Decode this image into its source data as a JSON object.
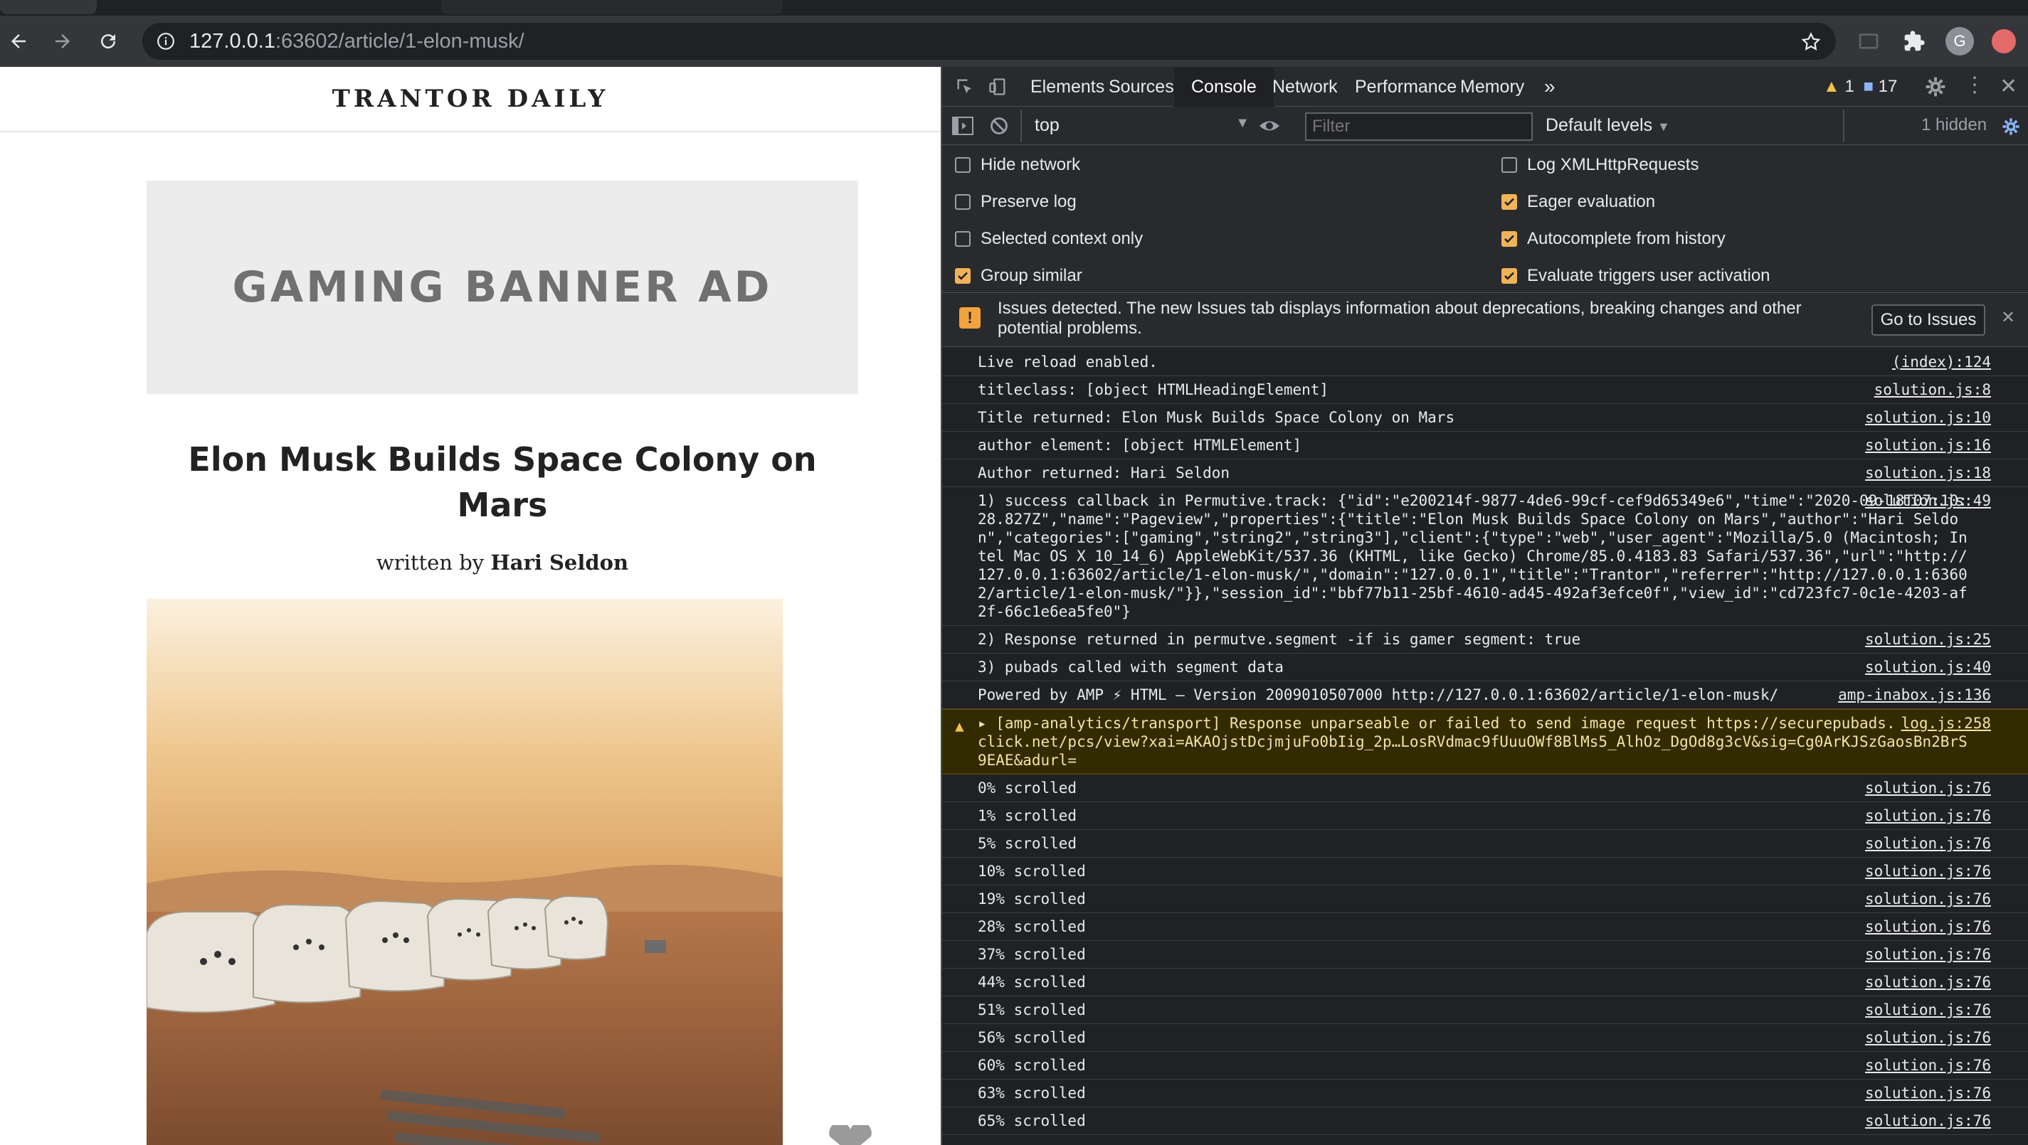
{
  "browser": {
    "url_host": "127.0.0.1",
    "url_path": ":63602/article/1-elon-musk/",
    "profile_initial": "G"
  },
  "page": {
    "masthead": "TRANTOR DAILY",
    "ad_text": "GAMING BANNER AD",
    "article_title": "Elon Musk Builds Space Colony on Mars",
    "byline_prefix": "written by",
    "author": "Hari Seldon"
  },
  "devtools": {
    "tabs": [
      "Elements",
      "Sources",
      "Console",
      "Network",
      "Performance",
      "Memory"
    ],
    "active_tab": "Console",
    "warnings_count": "1",
    "messages_count": "17",
    "context": "top",
    "filter_placeholder": "Filter",
    "levels": "Default levels",
    "hidden": "1 hidden",
    "settings_left": [
      {
        "label": "Hide network",
        "checked": false
      },
      {
        "label": "Preserve log",
        "checked": false
      },
      {
        "label": "Selected context only",
        "checked": false
      },
      {
        "label": "Group similar",
        "checked": true
      }
    ],
    "settings_right": [
      {
        "label": "Log XMLHttpRequests",
        "checked": false
      },
      {
        "label": "Eager evaluation",
        "checked": true
      },
      {
        "label": "Autocomplete from history",
        "checked": true
      },
      {
        "label": "Evaluate triggers user activation",
        "checked": true
      }
    ],
    "issues_text": "Issues detected. The new Issues tab displays information about deprecations, breaking changes and other potential problems.",
    "issues_button": "Go to Issues",
    "colors": {
      "warn_bg": "#332b00",
      "accent": "#8ab4f8",
      "checkbox": "#f0b35a"
    },
    "console": [
      {
        "text": "Live reload enabled.",
        "source": "(index):124"
      },
      {
        "text": "titleclass: [object HTMLHeadingElement]",
        "source": "solution.js:8"
      },
      {
        "text": "Title returned: Elon Musk Builds Space Colony on Mars",
        "source": "solution.js:10"
      },
      {
        "text": "author element: [object HTMLElement]",
        "source": "solution.js:16"
      },
      {
        "text": "Author returned: Hari Seldon",
        "source": "solution.js:18"
      },
      {
        "text": "1) success callback in Permutive.track: {\"id\":\"e200214f-9877-4de6-99cf-cef9d65349e6\",\"time\":\"2020-09-18T07:10:28.827Z\",\"name\":\"Pageview\",\"properties\":{\"title\":\"Elon Musk Builds Space Colony on Mars\",\"author\":\"Hari Seldon\",\"categories\":[\"gaming\",\"string2\",\"string3\"],\"client\":{\"type\":\"web\",\"user_agent\":\"Mozilla/5.0 (Macintosh; Intel Mac OS X 10_14_6) AppleWebKit/537.36 (KHTML, like Gecko) Chrome/85.0.4183.83 Safari/537.36\",\"url\":\"http://127.0.0.1:63602/article/1-elon-musk/\",\"domain\":\"127.0.0.1\",\"title\":\"Trantor\",\"referrer\":\"http://127.0.0.1:63602/article/1-elon-musk/\"}},\"session_id\":\"bbf77b11-25bf-4610-ad45-492af3efce0f\",\"view_id\":\"cd723fc7-0c1e-4203-af2f-66c1e6ea5fe0\"}",
        "source": "solution.js:49"
      },
      {
        "text": "2) Response returned in permutve.segment -if is gamer segment: true",
        "source": "solution.js:25"
      },
      {
        "text": "3) pubads called with segment data",
        "source": "solution.js:40"
      },
      {
        "text": "Powered by AMP ⚡ HTML – Version 2009010507000 http://127.0.0.1:63602/article/1-elon-musk/",
        "source": "amp-inabox.js:136"
      },
      {
        "text": "▸ [amp-analytics/transport] Response unparseable or failed to send image request https://securepubads.g.doubleclick.net/pcs/view?xai=AKAOjstDcjmjuFo0bIig_2p…LosRVdmac9fUuuOWf8BlMs5_AlhOz_DgOd8g3cV&sig=Cg0ArKJSzGaosBn2BrS9EAE&adurl=",
        "source": "log.js:258",
        "level": "warning"
      },
      {
        "text": "0% scrolled",
        "source": "solution.js:76"
      },
      {
        "text": "1% scrolled",
        "source": "solution.js:76"
      },
      {
        "text": "5% scrolled",
        "source": "solution.js:76"
      },
      {
        "text": "10% scrolled",
        "source": "solution.js:76"
      },
      {
        "text": "19% scrolled",
        "source": "solution.js:76"
      },
      {
        "text": "28% scrolled",
        "source": "solution.js:76"
      },
      {
        "text": "37% scrolled",
        "source": "solution.js:76"
      },
      {
        "text": "44% scrolled",
        "source": "solution.js:76"
      },
      {
        "text": "51% scrolled",
        "source": "solution.js:76"
      },
      {
        "text": "56% scrolled",
        "source": "solution.js:76"
      },
      {
        "text": "60% scrolled",
        "source": "solution.js:76"
      },
      {
        "text": "63% scrolled",
        "source": "solution.js:76"
      },
      {
        "text": "65% scrolled",
        "source": "solution.js:76"
      }
    ]
  }
}
